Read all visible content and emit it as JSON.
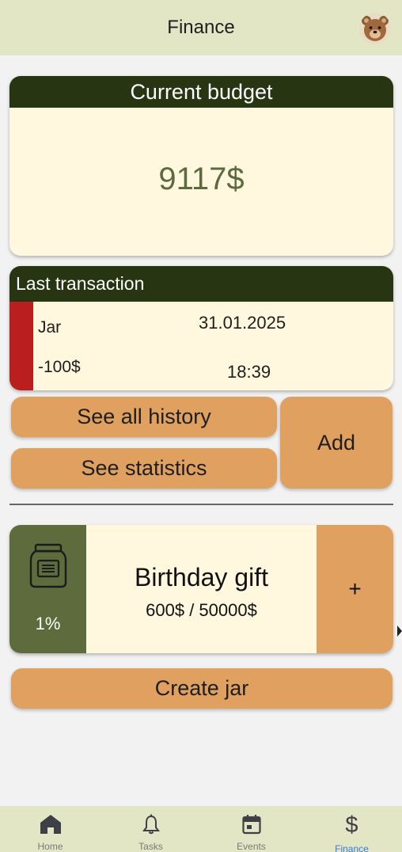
{
  "header": {
    "title": "Finance",
    "avatar_icon": "bear-avatar-icon"
  },
  "budget": {
    "title": "Current budget",
    "amount": "9117$"
  },
  "last_transaction": {
    "title": "Last transaction",
    "name": "Jar",
    "amount": "-100$",
    "date": "31.01.2025",
    "time": "18:39",
    "indicator_color": "#bb1e1e"
  },
  "actions": {
    "history": "See all history",
    "statistics": "See statistics",
    "add": "Add"
  },
  "jar": {
    "name": "Birthday gift",
    "amount": "600$ / 50000$",
    "percent": "1%",
    "add_label": "+",
    "icon": "jar-icon"
  },
  "create_jar": "Create jar",
  "nav": {
    "items": [
      {
        "label": "Home",
        "icon": "home-icon"
      },
      {
        "label": "Tasks",
        "icon": "bell-icon"
      },
      {
        "label": "Events",
        "icon": "calendar-icon"
      },
      {
        "label": "Finance",
        "icon": "dollar-icon",
        "active": true
      }
    ]
  },
  "colors": {
    "header_bg": "#e3e6c4",
    "card_head": "#273513",
    "card_body": "#fff8df",
    "button": "#dfa060",
    "jar_left": "#5d6b3d",
    "active_nav": "#3a7bd5"
  }
}
